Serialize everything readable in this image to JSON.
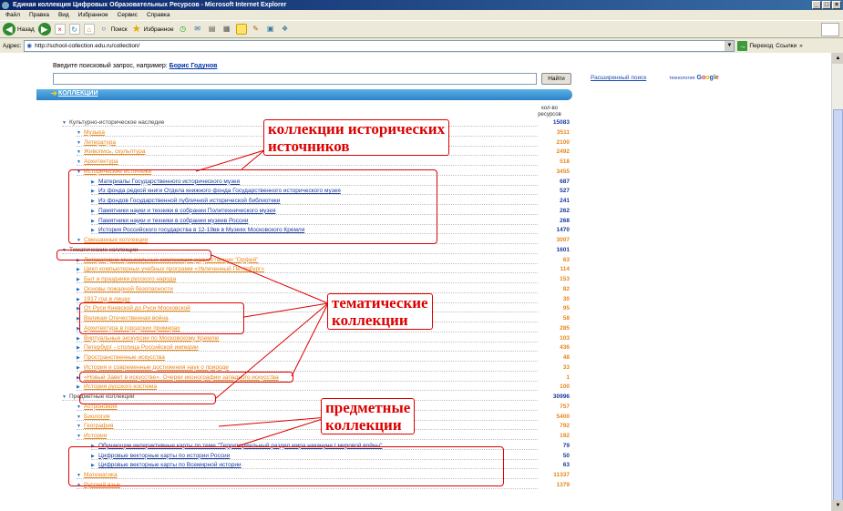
{
  "window": {
    "title": "Единая коллекция Цифровых Образовательных Ресурсов - Microsoft Internet Explorer"
  },
  "menu": [
    "Файл",
    "Правка",
    "Вид",
    "Избранное",
    "Сервис",
    "Справка"
  ],
  "toolbar": {
    "back": "Назад",
    "search": "Поиск",
    "favorites": "Избранное"
  },
  "address": {
    "label": "Адрес:",
    "url": "http://school-collection.edu.ru/collection/",
    "go": "Переход",
    "links": "Ссылки"
  },
  "search": {
    "hint": "Введите поисковый запрос, например:",
    "example": "Борис Годунов",
    "button": "Найти",
    "advanced": "Расширенный поиск",
    "tech": "технология",
    "google": [
      "G",
      "o",
      "o",
      "g",
      "l",
      "e"
    ]
  },
  "collections_bar": "КОЛЛЕКЦИИ",
  "count_header": [
    "кол-во",
    "ресурсов"
  ],
  "rows": [
    {
      "label": "Культурно-историческое наследие",
      "count": "15083",
      "level": 0,
      "style": "gray",
      "tri": "▼"
    },
    {
      "label": "Музыка",
      "count": "3511",
      "level": 1,
      "style": "orange",
      "tri": "▼"
    },
    {
      "label": "Литература",
      "count": "2100",
      "level": 1,
      "style": "orange",
      "tri": "▼"
    },
    {
      "label": "Живопись, скульптура",
      "count": "2492",
      "level": 1,
      "style": "orange",
      "tri": "▼"
    },
    {
      "label": "Архитектура",
      "count": "518",
      "level": 1,
      "style": "orange",
      "tri": "▼"
    },
    {
      "label": "Исторические источники",
      "count": "3455",
      "level": 1,
      "style": "orange",
      "tri": "▼"
    },
    {
      "label": "Материалы Государственного исторического музея",
      "count": "687",
      "level": 2,
      "style": "blue",
      "tri": "▶"
    },
    {
      "label": "Из фонда редкой книги Отдела книжного фонда Государственного исторического музея",
      "count": "527",
      "level": 2,
      "style": "blue",
      "tri": "▶"
    },
    {
      "label": "Из фондов Государственной публичной исторической библиотеки",
      "count": "241",
      "level": 2,
      "style": "blue",
      "tri": "▶"
    },
    {
      "label": "Памятники науки и техники в собрании Политехнического музея",
      "count": "262",
      "level": 2,
      "style": "blue",
      "tri": "▶"
    },
    {
      "label": "Памятники науки и техники в собрании музеев России",
      "count": "268",
      "level": 2,
      "style": "blue",
      "tri": "▶"
    },
    {
      "label": "История Российского государства в 12-19вв в Музеях Московского Кремля",
      "count": "1470",
      "level": 2,
      "style": "blue",
      "tri": "▶"
    },
    {
      "label": "Смешанные коллекции",
      "count": "3007",
      "level": 1,
      "style": "orange",
      "tri": "▼"
    },
    {
      "label": "Тематические коллекции",
      "count": "1601",
      "level": 0,
      "style": "gray",
      "tri": "▼"
    },
    {
      "label": "Литературно-музыкальные композиции радиостанции \"Орфей\"",
      "count": "63",
      "level": 1,
      "style": "orange",
      "tri": "▶"
    },
    {
      "label": "Цикл компьютерных учебных программ «Увлеченный Петербург»",
      "count": "114",
      "level": 1,
      "style": "orange",
      "tri": "▶"
    },
    {
      "label": "Быт и праздники русского народа",
      "count": "153",
      "level": 1,
      "style": "orange",
      "tri": "▶"
    },
    {
      "label": "Основы пожарной безопасности",
      "count": "82",
      "level": 1,
      "style": "orange",
      "tri": "▶"
    },
    {
      "label": "1917 год в лицах",
      "count": "30",
      "level": 1,
      "style": "orange",
      "tri": "▶"
    },
    {
      "label": "От Руси Киевской до Руси Московской",
      "count": "95",
      "level": 1,
      "style": "orange",
      "tri": "▶"
    },
    {
      "label": "Великая Отечественная война",
      "count": "58",
      "level": 1,
      "style": "orange",
      "tri": "▶"
    },
    {
      "label": "Архитектура в городских примерах",
      "count": "285",
      "level": 1,
      "style": "orange",
      "tri": "▶"
    },
    {
      "label": "Виртуальные экскурсии по Московскому Кремлю",
      "count": "103",
      "level": 1,
      "style": "orange",
      "tri": "▶"
    },
    {
      "label": "Петербург - столица Российской империи",
      "count": "436",
      "level": 1,
      "style": "orange",
      "tri": "▶"
    },
    {
      "label": "Пространственные искусства",
      "count": "48",
      "level": 1,
      "style": "orange",
      "tri": "▶"
    },
    {
      "label": "История и современные достижения наук о природе",
      "count": "33",
      "level": 1,
      "style": "orange",
      "tri": "▶"
    },
    {
      "label": "«Новый Завет в искусстве». Очерки иконографии западного искусства",
      "count": "1",
      "level": 1,
      "style": "orange",
      "tri": "▶"
    },
    {
      "label": "История русского костюма",
      "count": "100",
      "level": 1,
      "style": "orange",
      "tri": "▶"
    },
    {
      "label": "Предметные коллекции",
      "count": "30996",
      "level": 0,
      "style": "gray",
      "tri": "▼"
    },
    {
      "label": "Астрономия",
      "count": "757",
      "level": 1,
      "style": "orange",
      "tri": "▼"
    },
    {
      "label": "Биология",
      "count": "5400",
      "level": 1,
      "style": "orange",
      "tri": "▼"
    },
    {
      "label": "География",
      "count": "792",
      "level": 1,
      "style": "orange",
      "tri": "▼"
    },
    {
      "label": "История",
      "count": "192",
      "level": 1,
      "style": "orange",
      "tri": "▼"
    },
    {
      "label": "Обучающие интерактивные карты по теме \"Территориальный раздел мира накануне I мировой войны\"",
      "count": "79",
      "level": 2,
      "style": "blue",
      "tri": "▶"
    },
    {
      "label": "Цифровые векторные карты по истории России",
      "count": "50",
      "level": 2,
      "style": "blue",
      "tri": "▶"
    },
    {
      "label": "Цифровые векторные карты по Всемирной истории",
      "count": "63",
      "level": 2,
      "style": "blue",
      "tri": "▶"
    },
    {
      "label": "Математика",
      "count": "11337",
      "level": 1,
      "style": "orange",
      "tri": "▼"
    },
    {
      "label": "Русский язык",
      "count": "1379",
      "level": 1,
      "style": "orange",
      "tri": "▼"
    }
  ],
  "annotations": {
    "historical": [
      "коллекции исторических",
      "источников"
    ],
    "thematic": [
      "тематические",
      "коллекции"
    ],
    "subject": [
      "предметные",
      "коллекции"
    ]
  },
  "colors": {
    "orange": "#e8861a",
    "blue": "#1a3a9c",
    "red": "#d00000",
    "bar": "#2d82c8"
  }
}
